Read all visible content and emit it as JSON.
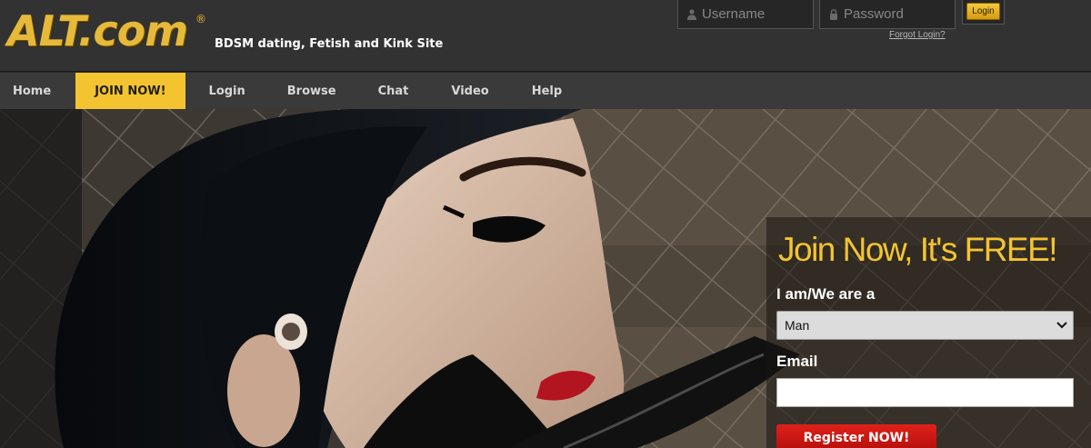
{
  "header": {
    "logo_text": "ALT.com",
    "logo_mark": "®",
    "tagline": "BDSM dating, Fetish and Kink Site",
    "username_placeholder": "Username",
    "password_placeholder": "Password",
    "login_button": "Login",
    "forgot_login": "Forgot Login?",
    "user_icon": "person-icon",
    "lock_icon": "lock-icon"
  },
  "nav": {
    "items": [
      {
        "label": "Home"
      },
      {
        "label": "JOIN NOW!"
      },
      {
        "label": "Login"
      },
      {
        "label": "Browse"
      },
      {
        "label": "Chat"
      },
      {
        "label": "Video"
      },
      {
        "label": "Help"
      }
    ]
  },
  "join": {
    "title": "Join Now, It's FREE!",
    "iam_label": "I am/We are a",
    "iam_selected": "Man",
    "email_label": "Email",
    "email_value": "",
    "register_button": "Register NOW!"
  },
  "colors": {
    "accent": "#f4c430",
    "register": "#d11a14",
    "header_bg": "#323232",
    "nav_bg": "#3a3a3a"
  }
}
